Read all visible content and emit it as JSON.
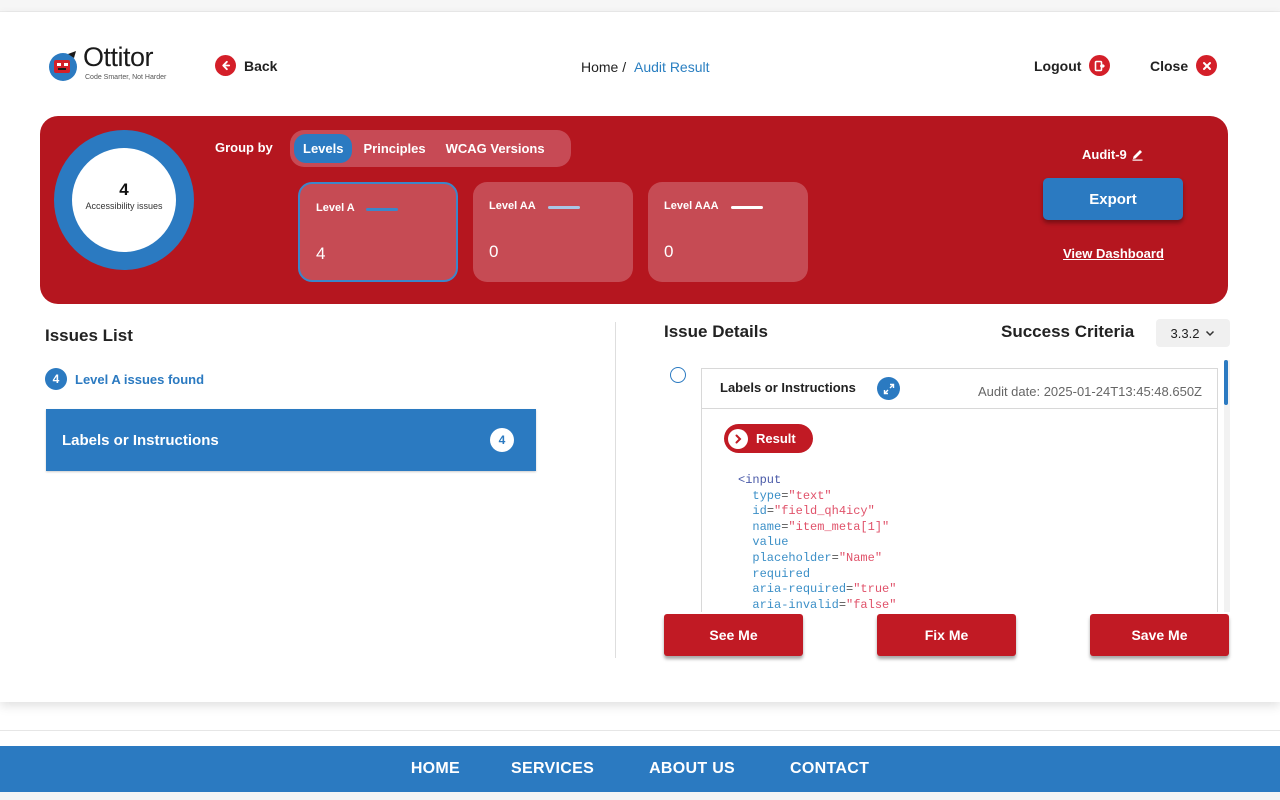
{
  "brand": {
    "name": "Ottitor",
    "tagline": "Code Smarter, Not Harder"
  },
  "header": {
    "back_label": "Back",
    "breadcrumb": {
      "home": "Home /",
      "current": "Audit Result"
    },
    "logout_label": "Logout",
    "close_label": "Close"
  },
  "summary": {
    "count": "4",
    "count_label": "Accessibility issues",
    "group_by_label": "Group by",
    "group_tabs": [
      {
        "label": "Levels",
        "active": true
      },
      {
        "label": "Principles",
        "active": false
      },
      {
        "label": "WCAG Versions",
        "active": false
      }
    ],
    "levels": [
      {
        "name": "Level A",
        "value": "4",
        "line_color": "#3c86c9"
      },
      {
        "name": "Level AA",
        "value": "0",
        "line_color": "#a9c6e6"
      },
      {
        "name": "Level AAA",
        "value": "0",
        "line_color": "#ffffff"
      }
    ],
    "audit_name": "Audit-9",
    "export_label": "Export",
    "dashboard_link": "View Dashboard"
  },
  "issues": {
    "title": "Issues List",
    "found_count": "4",
    "found_label": "Level A issues found",
    "items": [
      {
        "name": "Labels or Instructions",
        "count": "4"
      }
    ]
  },
  "details": {
    "title": "Issue Details",
    "success_criteria_label": "Success Criteria",
    "success_criteria_value": "3.3.2",
    "card_title": "Labels or Instructions",
    "audit_date": "Audit date: 2025-01-24T13:45:48.650Z",
    "result_label": "Result",
    "code": {
      "tag_open": "<input",
      "attrs": [
        {
          "name": "type",
          "value": "\"text\""
        },
        {
          "name": "id",
          "value": "\"field_qh4icy\""
        },
        {
          "name": "name",
          "value": "\"item_meta[1]\""
        },
        {
          "name": "value",
          "value": ""
        },
        {
          "name": "placeholder",
          "value": "\"Name\""
        },
        {
          "name": "required",
          "value": ""
        },
        {
          "name": "aria-required",
          "value": "\"true\""
        },
        {
          "name": "aria-invalid",
          "value": "\"false\""
        }
      ]
    },
    "actions": {
      "see": "See Me",
      "fix": "Fix Me",
      "save": "Save Me"
    }
  },
  "footer": {
    "links": [
      "HOME",
      "SERVICES",
      "ABOUT US",
      "CONTACT"
    ]
  },
  "colors": {
    "brand_red": "#b5161f",
    "accent_blue": "#2b7ac1",
    "button_red": "#c11a24"
  }
}
